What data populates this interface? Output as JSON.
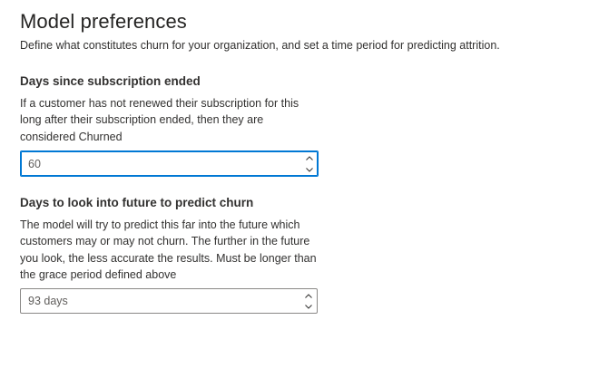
{
  "header": {
    "title": "Model preferences",
    "subtitle": "Define what constitutes churn for your organization, and set a time period for predicting attrition."
  },
  "sections": [
    {
      "heading": "Days since subscription ended",
      "description": "If a customer has not renewed their subscription for this long after their subscription ended, then they are considered Churned",
      "input_value": "60",
      "focused": true
    },
    {
      "heading": "Days to look into future to predict churn",
      "description": "The model will try to predict this far into the future which customers may or may not churn. The further in the future you look, the less accurate the results. Must be longer than the grace period defined above",
      "input_value": "93 days",
      "focused": false
    }
  ],
  "icons": {
    "increment": "chevron-up-icon",
    "decrement": "chevron-down-icon"
  },
  "colors": {
    "focus_border": "#0078d4",
    "default_border": "#8a8886",
    "text": "#323130",
    "value_text": "#605e5c"
  }
}
